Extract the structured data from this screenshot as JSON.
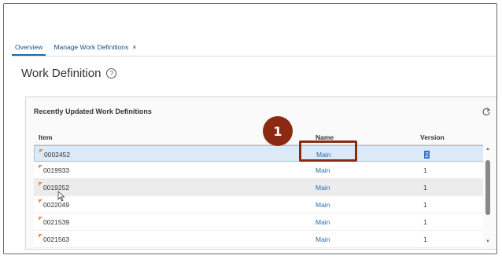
{
  "tabs": [
    {
      "label": "Overview",
      "active": true
    },
    {
      "label": "Manage Work Definitions",
      "closable": true,
      "close_glyph": "×"
    }
  ],
  "page": {
    "title": "Work Definition",
    "help_glyph": "?"
  },
  "card": {
    "title": "Recently Updated Work Definitions",
    "columns": {
      "item": "Item",
      "name": "Name",
      "version": "Version"
    },
    "rows": [
      {
        "item": "0002452",
        "name": "Main",
        "version": "2",
        "selected": true
      },
      {
        "item": "0019933",
        "name": "Main",
        "version": "1"
      },
      {
        "item": "0019252",
        "name": "Main",
        "version": "1"
      },
      {
        "item": "0022049",
        "name": "Main",
        "version": "1"
      },
      {
        "item": "0021539",
        "name": "Main",
        "version": "1"
      },
      {
        "item": "0021563",
        "name": "Main",
        "version": "1"
      }
    ]
  },
  "callout": {
    "number": "1"
  },
  "colors": {
    "accent": "#1f6aa5",
    "callout": "#8b2a12",
    "link": "#2a6cab",
    "flag": "#e8905a"
  },
  "icons": [
    "close-icon",
    "help-icon",
    "refresh-icon",
    "flag-icon",
    "scroll-up-icon",
    "scroll-down-icon",
    "mouse-cursor-icon"
  ]
}
